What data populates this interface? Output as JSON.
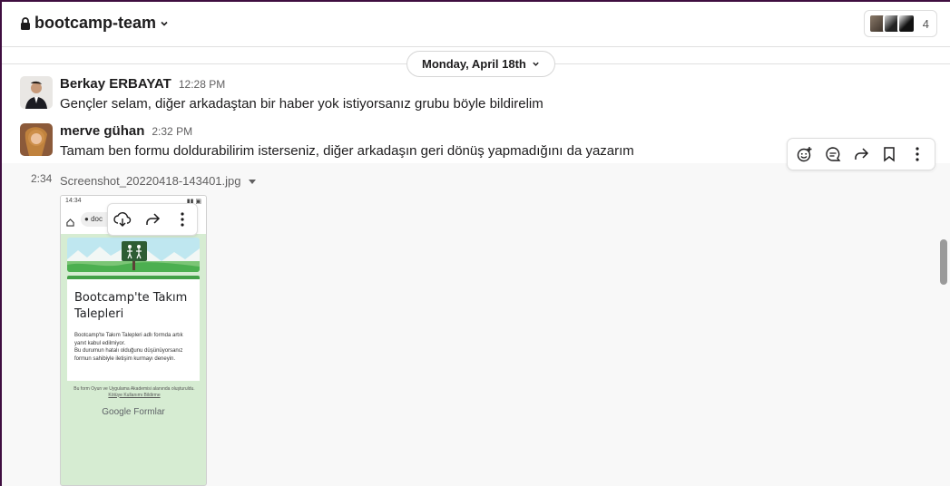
{
  "channel": {
    "name": "bootcamp-team",
    "member_count": "4"
  },
  "date_divider": {
    "label": "Monday, April 18th"
  },
  "messages": [
    {
      "author": "Berkay ERBAYAT",
      "time": "12:28 PM",
      "text": "Gençler selam, diğer arkadaştan bir haber yok istiyorsanız grubu böyle bildirelim"
    },
    {
      "author": "merve gühan",
      "time": "2:32 PM",
      "text": "Tamam ben formu doldurabilirim isterseniz, diğer arkadaşın geri dönüş yapmadığını da yazarım"
    }
  ],
  "attachment": {
    "time": "2:34",
    "file_name": "Screenshot_20220418-143401.jpg",
    "preview": {
      "status_time": "14:34",
      "url_text": "doc",
      "form_title": "Bootcamp'te Takım Talepleri",
      "form_desc_1": "Bootcamp'te Takım Talepleri adlı formda artık yanıt kabul edilmiyor.",
      "form_desc_2": "Bu durumun hatalı olduğunu düşünüyorsanız formun sahibiyle iletişim kurmayı deneyin.",
      "footer_text": "Bu form Oyun ve Uygulama Akademisi alanında oluşturuldu.",
      "footer_link": "Kötüye Kullanımı Bildirme",
      "brand_google": "Google",
      "brand_forms": "Formlar"
    }
  },
  "icons": {
    "lock": "lock-icon",
    "chevron": "chevron-down-icon",
    "actions": [
      "add-reaction-icon",
      "reply-thread-icon",
      "share-icon",
      "bookmark-icon",
      "more-icon"
    ],
    "image_actions": [
      "download-icon",
      "share-icon",
      "more-icon"
    ]
  },
  "colors": {
    "sidebar_border": "#3f0e40",
    "banner_green": "#43a047",
    "preview_bg": "#d6ecd2"
  }
}
